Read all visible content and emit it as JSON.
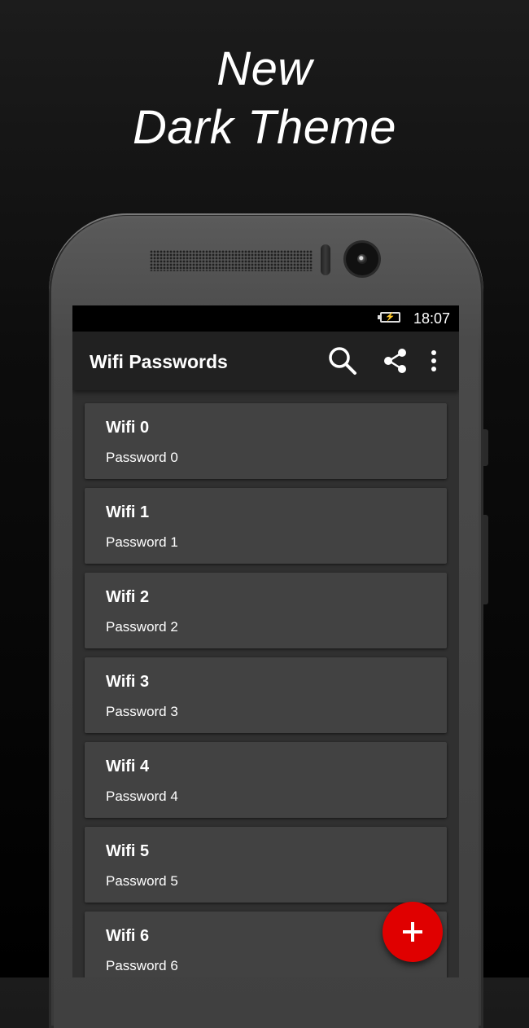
{
  "promo": {
    "line1": "New",
    "line2": "Dark Theme"
  },
  "statusbar": {
    "battery_icon": "battery-charging-icon",
    "time": "18:07"
  },
  "appbar": {
    "title": "Wifi Passwords",
    "icons": [
      "search-icon",
      "share-icon",
      "more-vert-icon"
    ]
  },
  "wifi_list": [
    {
      "ssid": "Wifi 0",
      "password": "Password 0"
    },
    {
      "ssid": "Wifi 1",
      "password": "Password 1"
    },
    {
      "ssid": "Wifi 2",
      "password": "Password 2"
    },
    {
      "ssid": "Wifi 3",
      "password": "Password 3"
    },
    {
      "ssid": "Wifi 4",
      "password": "Password 4"
    },
    {
      "ssid": "Wifi 5",
      "password": "Password 5"
    },
    {
      "ssid": "Wifi 6",
      "password": "Password 6"
    }
  ],
  "fab": {
    "icon": "plus-icon",
    "color": "#e00000"
  },
  "colors": {
    "appbar": "#212121",
    "card": "#424242",
    "screen_bg": "#303030"
  }
}
